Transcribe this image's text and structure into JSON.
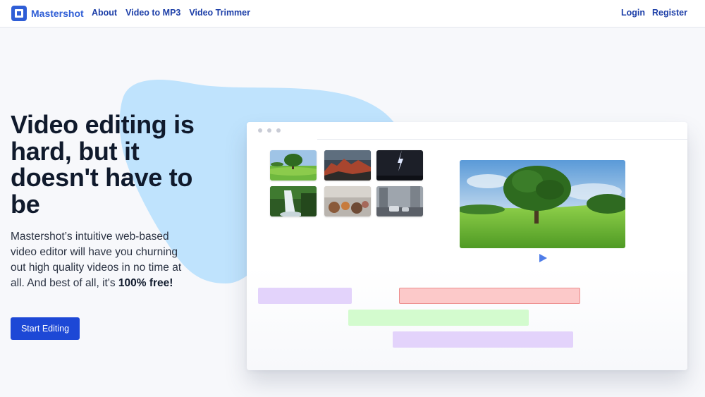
{
  "nav": {
    "brand": "Mastershot",
    "links": [
      "About",
      "Video to MP3",
      "Video Trimmer"
    ],
    "login": "Login",
    "register": "Register"
  },
  "hero": {
    "title": "Video editing is hard, but it doesn't have to be",
    "description": "Mastershot’s intuitive web-based video editor will have you churning out high quality videos in no time at all. And best of all, it's ",
    "description_emphasis": "100% free!",
    "cta_label": "Start Editing"
  },
  "editor": {
    "thumbnails": [
      "tree-meadow",
      "red-mountains",
      "lightning-storm",
      "waterfall",
      "market-scene",
      "city-street"
    ],
    "preview": "tree-meadow",
    "play_icon": "play-icon",
    "clip_colors": [
      "#e3d3fb",
      "#fcc9c9",
      "#d3fbce",
      "#e3d3fb"
    ]
  },
  "colors": {
    "brand": "#2f5ed6",
    "cta": "#1d48d6",
    "blob": "#bfe3fd"
  }
}
